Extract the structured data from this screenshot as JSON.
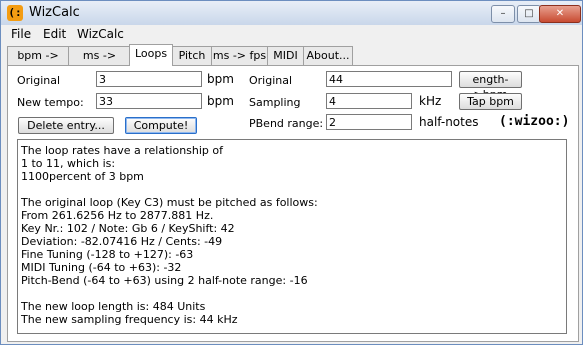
{
  "window": {
    "title": "WizCalc",
    "app_icon_glyph": "(:",
    "minimize_glyph": "–",
    "maximize_glyph": "□",
    "close_glyph": "✕"
  },
  "menu": [
    "File",
    "Edit",
    "WizCalc"
  ],
  "tabs": [
    {
      "label": "bpm -> ms",
      "active": false
    },
    {
      "label": "ms -> bpm",
      "active": false
    },
    {
      "label": "Loops",
      "active": true
    },
    {
      "label": "Pitch",
      "active": false
    },
    {
      "label": "ms -> fps",
      "active": false
    },
    {
      "label": "MIDI",
      "active": false
    },
    {
      "label": "About...",
      "active": false
    }
  ],
  "loops": {
    "original_label": "Original",
    "original_value": "3",
    "original_unit": "bpm",
    "new_tempo_label": "New tempo:",
    "new_tempo_value": "33",
    "new_tempo_unit": "bpm",
    "original2_label": "Original",
    "original2_value": "44",
    "length_to_bpm_button": "ength->bpm",
    "sampling_label": "Sampling",
    "sampling_value": "4",
    "sampling_unit": "kHz",
    "tap_bpm_button": "Tap bpm",
    "delete_entry_button": "Delete entry...",
    "compute_button": "Compute!",
    "pbend_label": "PBend range:",
    "pbend_value": "2",
    "pbend_unit": "half-notes",
    "logo_text": "(:wizoo:)"
  },
  "output_lines": [
    "The loop rates have a relationship of",
    "1 to 11, which is:",
    "1100percent of 3 bpm",
    "",
    "The original loop (Key C3) must be pitched as follows:",
    "From 261.6256 Hz to 2877.881 Hz.",
    "Key Nr.: 102 / Note: Gb 6 / KeyShift: 42",
    "Deviation: -82.07416 Hz / Cents: -49",
    "Fine Tuning (-128 to +127): -63",
    "MIDI Tuning (-64 to +63): -32",
    "Pitch-Bend (-64 to +63) using 2 half-note range: -16",
    "",
    "The new loop length is: 484 Units",
    "The new sampling frequency is: 44 kHz"
  ]
}
